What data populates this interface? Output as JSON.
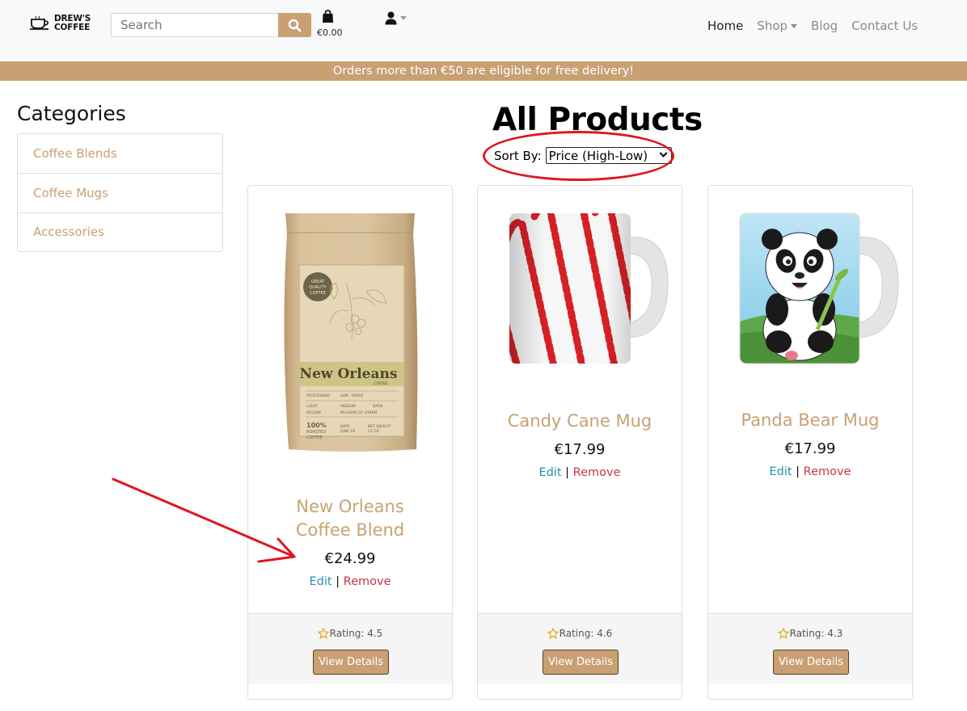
{
  "brand": {
    "line1": "DREW'S",
    "line2": "COFFEE"
  },
  "search": {
    "placeholder": "Search"
  },
  "cart": {
    "total": "€0.00"
  },
  "nav": {
    "home": "Home",
    "shop": "Shop",
    "blog": "Blog",
    "contact": "Contact Us"
  },
  "banner": {
    "text": "Orders more than €50 are eligible for free delivery!"
  },
  "sidebar": {
    "title": "Categories",
    "items": [
      {
        "label": "Coffee Blends"
      },
      {
        "label": "Coffee Mugs"
      },
      {
        "label": "Accessories"
      }
    ]
  },
  "main": {
    "title": "All Products",
    "sort_label": "Sort By:",
    "sort_value": "Price (High-Low)"
  },
  "products": [
    {
      "name_line1": "New Orleans",
      "name_line2": "Coffee Blend",
      "price": "€24.99",
      "rating": "Rating: 4.5",
      "edit": "Edit",
      "remove": "Remove",
      "view": "View Details",
      "bag": {
        "badge1": "GREAT",
        "badge2": "QUALITY",
        "badge3": "COFFEE",
        "title": "New Orleans",
        "sub": "COFFEE",
        "p1": "PROCESSING",
        "p2": "SUN - DRIED",
        "r1": "LIGHT",
        "r2": "MEDIUM",
        "r3": "DARK",
        "g1": "REGION",
        "g2": "REGIONS OF LOREM",
        "b1": "100%",
        "b2": "ROASTED",
        "b3": "COFFEE",
        "d1": "DATE",
        "d2": "JUNE 16",
        "w1": "NET WEIGHT",
        "w2": "12 OZ"
      }
    },
    {
      "name": "Candy Cane Mug",
      "price": "€17.99",
      "rating": "Rating: 4.6",
      "edit": "Edit",
      "remove": "Remove",
      "view": "View Details"
    },
    {
      "name": "Panda Bear Mug",
      "price": "€17.99",
      "rating": "Rating: 4.3",
      "edit": "Edit",
      "remove": "Remove",
      "view": "View Details"
    }
  ],
  "colors": {
    "accent": "#c9a074",
    "edit": "#2a8fb0",
    "remove": "#c9354a",
    "annotation": "#e0151f"
  }
}
